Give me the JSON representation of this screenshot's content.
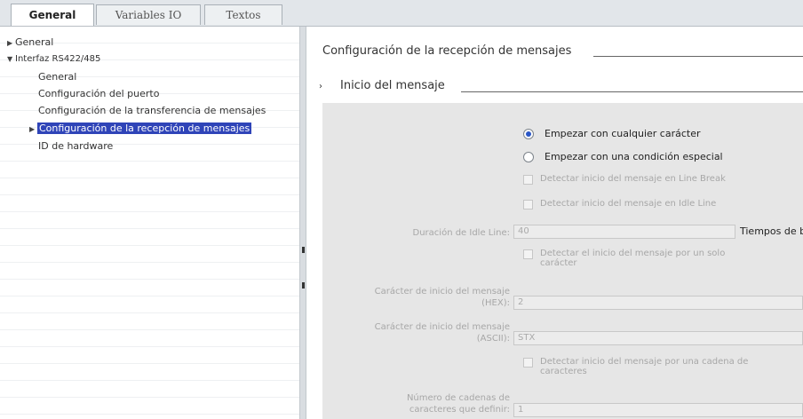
{
  "tabs": [
    {
      "label": "General"
    },
    {
      "label": "Variables IO"
    },
    {
      "label": "Textos"
    }
  ],
  "tree": {
    "items": [
      {
        "label": "General"
      },
      {
        "label": "Interfaz RS422/485"
      },
      {
        "label": "General"
      },
      {
        "label": "Configuración del puerto"
      },
      {
        "label": "Configuración de la transferencia de mensajes"
      },
      {
        "label": "Configuración de la recepción de mensajes"
      },
      {
        "label": "ID de hardware"
      }
    ]
  },
  "content": {
    "section_title": "Configuración de la recepción de mensajes",
    "subsection_title": "Inicio del mensaje",
    "radio_any": "Empezar con cualquier carácter",
    "radio_special": "Empezar con una condición especial",
    "check_line_break": "Detectar inicio del mensaje en Line Break",
    "check_idle_line": "Detectar inicio del mensaje en Idle Line",
    "idle_label": "Duración de Idle Line:",
    "idle_value": "40",
    "idle_unit": "Tiempos de bit",
    "check_single_char_1": "Detectar el inicio del mensaje por un solo",
    "check_single_char_2": "carácter",
    "start_hex_label_1": "Carácter de inicio del mensaje",
    "start_hex_label_2": "(HEX):",
    "start_hex_value": "2",
    "start_ascii_label_1": "Carácter de inicio del mensaje",
    "start_ascii_label_2": "(ASCII):",
    "start_ascii_value": "STX",
    "check_string_1": "Detectar inicio del mensaje por una cadena de",
    "check_string_2": "caracteres",
    "num_strings_label_1": "Número de cadenas de",
    "num_strings_label_2": "caracteres que definir:",
    "num_strings_value": "1"
  },
  "colors": {
    "selection": "#2f44b8",
    "radio_dot": "#2a56c6"
  }
}
